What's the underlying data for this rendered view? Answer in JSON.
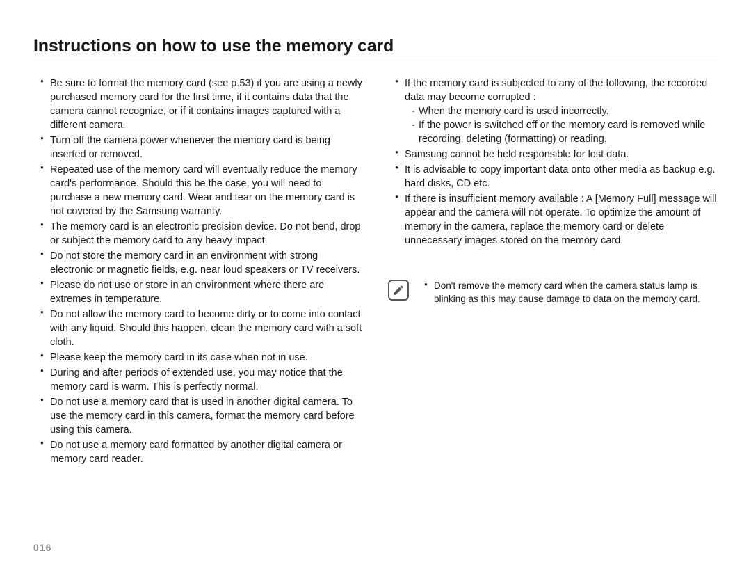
{
  "title": "Instructions on how to use the memory card",
  "page_number": "016",
  "left_bullets": [
    "Be sure to format the memory card (see p.53) if you are using a newly purchased memory card for the first time, if it contains data that the camera cannot recognize, or if it contains images captured with a different camera.",
    "Turn off the camera power whenever the memory card is being inserted or removed.",
    "Repeated use of the memory card will eventually reduce the memory card's performance. Should this be the case, you will need to purchase a new memory card. Wear and tear on the memory card is not covered by the Samsung warranty.",
    "The memory card is an electronic precision device. Do not bend, drop or subject the memory card to any heavy impact.",
    "Do not store the memory card in an environment with strong electronic or magnetic fields, e.g. near loud speakers or TV receivers.",
    "Please do not use or store in an environment where there are extremes in temperature.",
    "Do not allow the memory card to become dirty or to come into contact with any liquid. Should this happen, clean the memory card with a soft cloth.",
    "Please keep the memory card in its case when not in use.",
    "During and after periods of extended use, you may notice that the memory card is warm. This is perfectly normal.",
    "Do not use a memory card that is used in another digital camera. To use the memory card in this camera, format the memory card before using this camera.",
    "Do not use a memory card formatted by another digital camera or memory card reader."
  ],
  "right_bullet_0_lead": "If the memory card is subjected to any of the following, the recorded data may become corrupted :",
  "right_bullet_0_sub": [
    "When the memory card is used incorrectly.",
    "If the power is switched off or the memory card is removed while recording, deleting (formatting) or reading."
  ],
  "right_bullet_1": "Samsung cannot be held responsible for lost data.",
  "right_bullet_2": "It is advisable to copy important data onto other media as backup e.g. hard disks, CD etc.",
  "right_bullet_3": "If there is insufficient memory available : A [Memory Full] message will appear and the camera will not operate. To optimize the amount of memory in the camera, replace the memory card or delete unnecessary images stored on the memory card.",
  "note_text": "Don't remove the memory card when the camera status lamp is blinking as this may cause damage to data on the memory card.",
  "note_icon_name": "note-icon"
}
